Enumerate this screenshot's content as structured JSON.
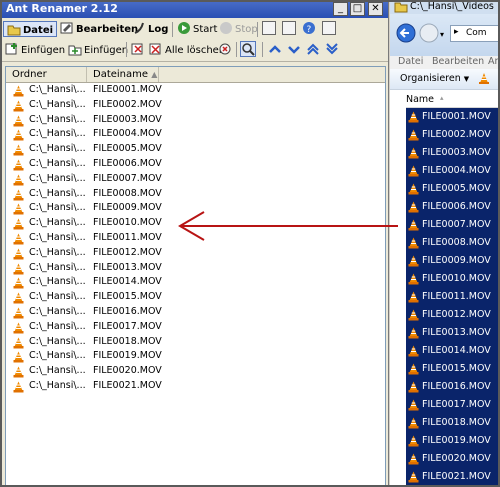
{
  "ant": {
    "title": "Ant Renamer 2.12",
    "toolbar1": {
      "datei": "Datei",
      "bearbeiten": "Bearbeiten",
      "log": "Log",
      "start": "Start",
      "stop": "Stop"
    },
    "toolbar2": {
      "einfuegen1": "Einfügen",
      "einfuegen2": "Einfügen",
      "alle_loeschen": "Alle löschen"
    },
    "columns": {
      "ordner": "Ordner",
      "dateiname": "Dateiname"
    },
    "rows": [
      {
        "ordner": "C:\\_Hansi\\...",
        "file": "FILE0001.MOV"
      },
      {
        "ordner": "C:\\_Hansi\\...",
        "file": "FILE0002.MOV"
      },
      {
        "ordner": "C:\\_Hansi\\...",
        "file": "FILE0003.MOV"
      },
      {
        "ordner": "C:\\_Hansi\\...",
        "file": "FILE0004.MOV"
      },
      {
        "ordner": "C:\\_Hansi\\...",
        "file": "FILE0005.MOV"
      },
      {
        "ordner": "C:\\_Hansi\\...",
        "file": "FILE0006.MOV"
      },
      {
        "ordner": "C:\\_Hansi\\...",
        "file": "FILE0007.MOV"
      },
      {
        "ordner": "C:\\_Hansi\\...",
        "file": "FILE0008.MOV"
      },
      {
        "ordner": "C:\\_Hansi\\...",
        "file": "FILE0009.MOV"
      },
      {
        "ordner": "C:\\_Hansi\\...",
        "file": "FILE0010.MOV"
      },
      {
        "ordner": "C:\\_Hansi\\...",
        "file": "FILE0011.MOV"
      },
      {
        "ordner": "C:\\_Hansi\\...",
        "file": "FILE0012.MOV"
      },
      {
        "ordner": "C:\\_Hansi\\...",
        "file": "FILE0013.MOV"
      },
      {
        "ordner": "C:\\_Hansi\\...",
        "file": "FILE0014.MOV"
      },
      {
        "ordner": "C:\\_Hansi\\...",
        "file": "FILE0015.MOV"
      },
      {
        "ordner": "C:\\_Hansi\\...",
        "file": "FILE0016.MOV"
      },
      {
        "ordner": "C:\\_Hansi\\...",
        "file": "FILE0017.MOV"
      },
      {
        "ordner": "C:\\_Hansi\\...",
        "file": "FILE0018.MOV"
      },
      {
        "ordner": "C:\\_Hansi\\...",
        "file": "FILE0019.MOV"
      },
      {
        "ordner": "C:\\_Hansi\\...",
        "file": "FILE0020.MOV"
      },
      {
        "ordner": "C:\\_Hansi\\...",
        "file": "FILE0021.MOV"
      }
    ]
  },
  "explorer": {
    "title": "C:\\_Hansi\\_Videos",
    "address": "Com",
    "menu": [
      "Datei",
      "Bearbeiten",
      "An"
    ],
    "organize": "Organisieren",
    "column": "Name",
    "files": [
      "FILE0001.MOV",
      "FILE0002.MOV",
      "FILE0003.MOV",
      "FILE0004.MOV",
      "FILE0005.MOV",
      "FILE0006.MOV",
      "FILE0007.MOV",
      "FILE0008.MOV",
      "FILE0009.MOV",
      "FILE0010.MOV",
      "FILE0011.MOV",
      "FILE0012.MOV",
      "FILE0013.MOV",
      "FILE0014.MOV",
      "FILE0015.MOV",
      "FILE0016.MOV",
      "FILE0017.MOV",
      "FILE0018.MOV",
      "FILE0019.MOV",
      "FILE0020.MOV",
      "FILE0021.MOV"
    ]
  },
  "colors": {
    "selection": "#0a246a",
    "arrow": "#b81414",
    "cone": "#f08a00"
  }
}
